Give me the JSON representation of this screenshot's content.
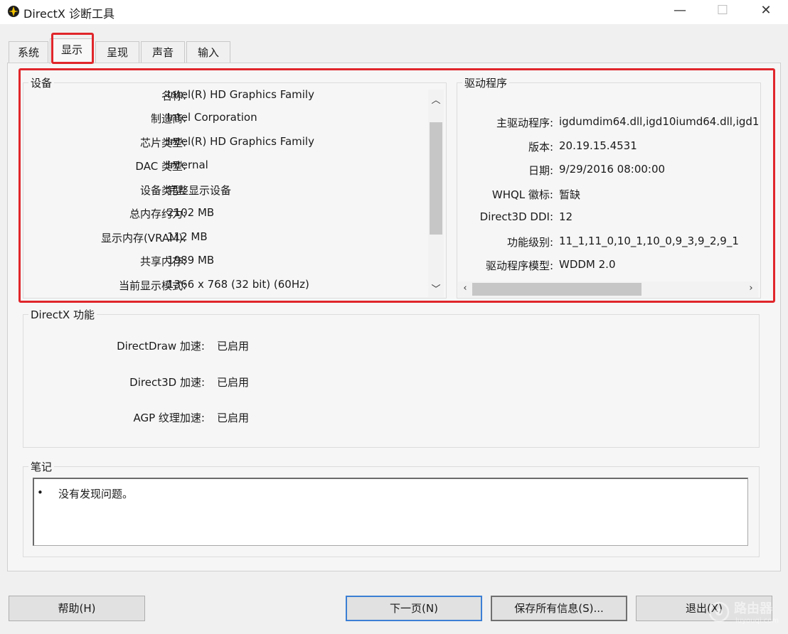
{
  "window": {
    "title": "DirectX 诊断工具",
    "controls": {
      "minimize": "—",
      "maximize": "☐",
      "close": "✕"
    }
  },
  "tabs": [
    {
      "label": "系统",
      "active": false
    },
    {
      "label": "显示",
      "active": true
    },
    {
      "label": "呈现",
      "active": false
    },
    {
      "label": "声音",
      "active": false
    },
    {
      "label": "输入",
      "active": false
    }
  ],
  "device": {
    "title": "设备",
    "rows": [
      {
        "label": "名称:",
        "value": "Intel(R) HD Graphics Family"
      },
      {
        "label": "制造商:",
        "value": "Intel Corporation"
      },
      {
        "label": "芯片类型:",
        "value": "Intel(R) HD Graphics Family"
      },
      {
        "label": "DAC 类型:",
        "value": "Internal"
      },
      {
        "label": "设备类型:",
        "value": "完整显示设备"
      },
      {
        "label": "总内存约为:",
        "value": "2102 MB"
      },
      {
        "label": "显示内存(VRAM):",
        "value": "112 MB"
      },
      {
        "label": "共享内存:",
        "value": "1989 MB"
      },
      {
        "label": "当前显示模式:",
        "value": "1366 x 768 (32 bit) (60Hz)"
      }
    ]
  },
  "driver": {
    "title": "驱动程序",
    "rows": [
      {
        "label": "主驱动程序:",
        "value": "igdumdim64.dll,igd10iumd64.dll,igd1"
      },
      {
        "label": "版本:",
        "value": "20.19.15.4531"
      },
      {
        "label": "日期:",
        "value": "9/29/2016 08:00:00"
      },
      {
        "label": "WHQL 徽标:",
        "value": "暂缺"
      },
      {
        "label": "Direct3D DDI:",
        "value": "12"
      },
      {
        "label": "功能级别:",
        "value": "11_1,11_0,10_1,10_0,9_3,9_2,9_1"
      },
      {
        "label": "驱动程序模型:",
        "value": "WDDM 2.0"
      }
    ]
  },
  "directx_features": {
    "title": "DirectX 功能",
    "rows": [
      {
        "label": "DirectDraw 加速:",
        "value": "已启用"
      },
      {
        "label": "Direct3D 加速:",
        "value": "已启用"
      },
      {
        "label": "AGP 纹理加速:",
        "value": "已启用"
      }
    ]
  },
  "notes": {
    "title": "笔记",
    "items": [
      "没有发现问题。"
    ]
  },
  "buttons": {
    "help": "帮助(H)",
    "next": "下一页(N)",
    "save_all": "保存所有信息(S)...",
    "exit": "退出(X)"
  },
  "watermark": {
    "text": "路由器",
    "url": "luyouqi.com"
  },
  "colors": {
    "highlight": "#e0262b",
    "default_button_border": "#3c7fd4",
    "app_icon": "#f2c200"
  }
}
